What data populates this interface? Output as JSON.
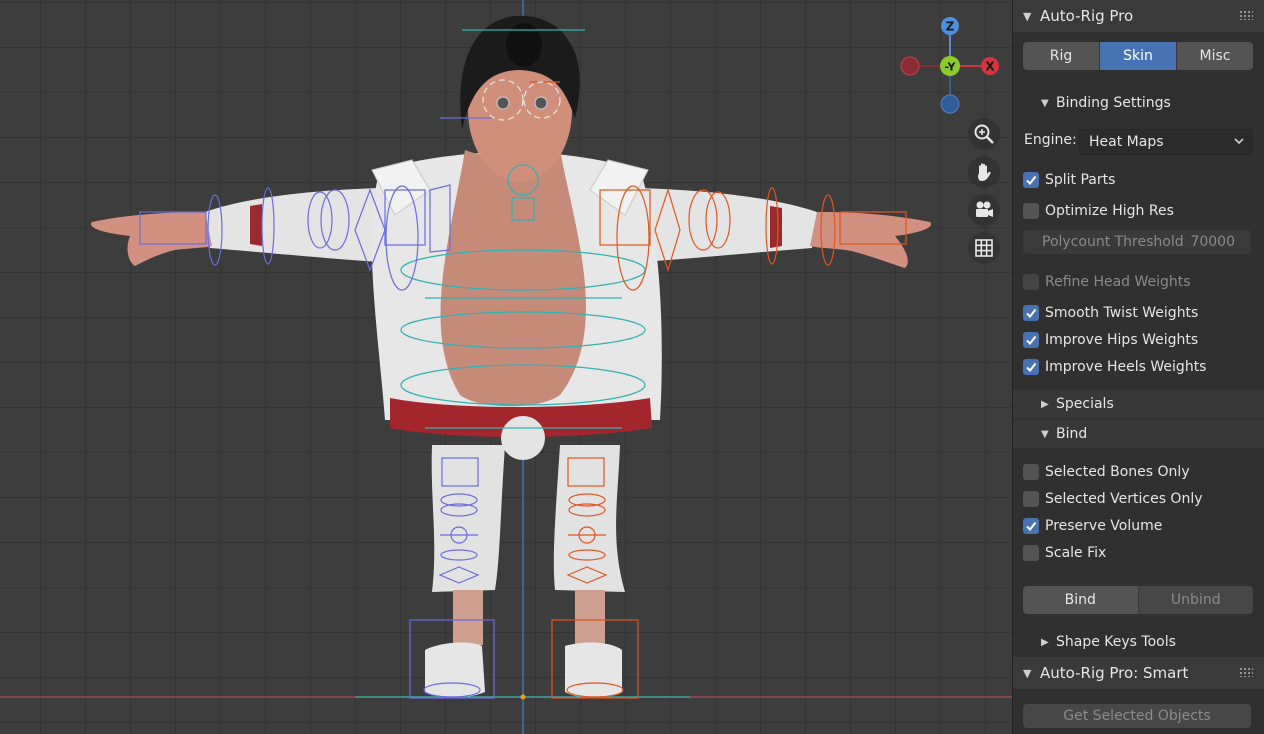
{
  "viewport": {
    "gizmo": {
      "z": "Z",
      "y": "-Y",
      "x": "X"
    },
    "nav_buttons": [
      "zoom-icon",
      "hand-pan-icon",
      "camera-icon",
      "grid-icon"
    ]
  },
  "panel": {
    "header": "Auto-Rig Pro",
    "tabs": [
      {
        "label": "Rig",
        "active": false
      },
      {
        "label": "Skin",
        "active": true
      },
      {
        "label": "Misc",
        "active": false
      }
    ],
    "binding_settings": {
      "title": "Binding Settings",
      "engine_label": "Engine:",
      "engine_value": "Heat Maps",
      "split_parts": {
        "label": "Split Parts",
        "checked": true
      },
      "optimize_high_res": {
        "label": "Optimize High Res",
        "checked": false
      },
      "polycount": {
        "label": "Polycount Threshold",
        "value": "70000"
      },
      "refine_head": {
        "label": "Refine Head Weights",
        "checked": false,
        "enabled": false
      },
      "smooth_twist": {
        "label": "Smooth Twist Weights",
        "checked": true
      },
      "improve_hips": {
        "label": "Improve Hips Weights",
        "checked": true
      },
      "improve_heels": {
        "label": "Improve Heels Weights",
        "checked": true
      }
    },
    "specials": "Specials",
    "bind": {
      "title": "Bind",
      "selected_bones": {
        "label": "Selected Bones Only",
        "checked": false
      },
      "selected_vertices": {
        "label": "Selected Vertices Only",
        "checked": false
      },
      "preserve_volume": {
        "label": "Preserve Volume",
        "checked": true
      },
      "scale_fix": {
        "label": "Scale Fix",
        "checked": false
      },
      "bind_button": "Bind",
      "unbind_button": "Unbind"
    },
    "shape_keys": "Shape Keys Tools",
    "smart_header": "Auto-Rig Pro: Smart",
    "get_selected": "Get Selected Objects"
  },
  "colors": {
    "accent": "#4772b3",
    "left_rig": "#6b6be0",
    "right_rig": "#e0561f",
    "center_rig": "#2fb3b3"
  }
}
